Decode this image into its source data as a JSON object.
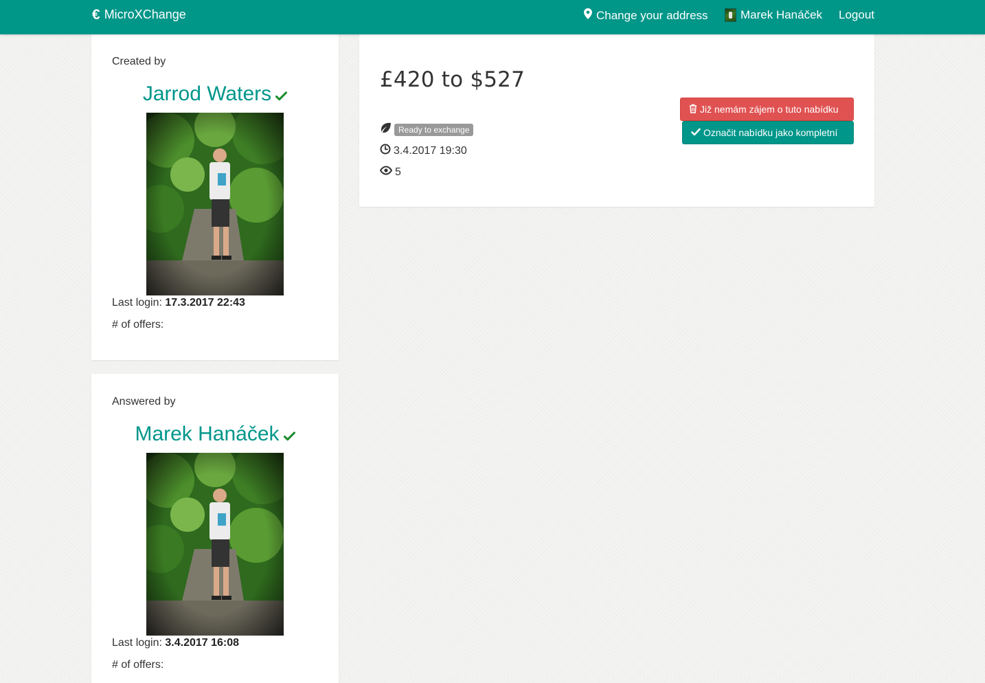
{
  "navbar": {
    "brand_icon": "€",
    "brand_text": "MicroXChange",
    "change_address": "Change your address",
    "user_name": "Marek Hanáček",
    "logout": "Logout",
    "bg_color": "#009688"
  },
  "creator": {
    "label": "Created by",
    "name": "Jarrod Waters",
    "last_login_label": "Last login:",
    "last_login_value": "17.3.2017 22:43",
    "offers_label": "# of offers:"
  },
  "answerer": {
    "label": "Answered by",
    "name": "Marek Hanáček",
    "last_login_label": "Last login:",
    "last_login_value": "3.4.2017 16:08",
    "offers_label": "# of offers:"
  },
  "offer": {
    "title": "£420 to $527",
    "status": "Ready to exchange",
    "date": "3.4.2017 19:30",
    "views": "5",
    "btn_not_interested": "Již nemám zájem o tuto nabídku",
    "btn_mark_complete": "Označit nabídku jako kompletní"
  },
  "icons": {
    "brand": "euro-icon",
    "address": "map-marker-icon",
    "verified": "check-icon",
    "status": "leaf-icon",
    "date": "clock-icon",
    "views": "eye-icon",
    "delete": "trash-icon",
    "complete": "check-icon"
  },
  "colors": {
    "accent": "#009688",
    "danger": "#e05252",
    "verified": "#1a8a2a"
  }
}
